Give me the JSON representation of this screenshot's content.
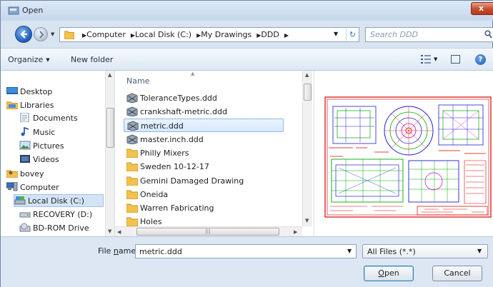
{
  "window": {
    "title": "Open",
    "close_glyph": "x"
  },
  "address": {
    "crumbs": [
      "Computer",
      "Local Disk (C:)",
      "My Drawings",
      "DDD"
    ],
    "search_placeholder": "Search DDD"
  },
  "toolbar": {
    "organize": "Organize",
    "new_folder": "New folder"
  },
  "nav": {
    "items": [
      {
        "label": "Desktop",
        "icon": "desktop-icon"
      },
      {
        "label": "Libraries",
        "icon": "libraries-icon"
      },
      {
        "label": "Documents",
        "icon": "documents-icon"
      },
      {
        "label": "Music",
        "icon": "music-icon"
      },
      {
        "label": "Pictures",
        "icon": "pictures-icon"
      },
      {
        "label": "Videos",
        "icon": "videos-icon"
      },
      {
        "label": "bovey",
        "icon": "user-folder-icon"
      },
      {
        "label": "Computer",
        "icon": "computer-icon"
      },
      {
        "label": "Local Disk (C:)",
        "icon": "local-disk-icon",
        "selected": true
      },
      {
        "label": "RECOVERY (D:)",
        "icon": "drive-icon"
      },
      {
        "label": "BD-ROM Drive",
        "icon": "bd-rom-icon"
      }
    ]
  },
  "files": {
    "column_header": "Name",
    "items": [
      {
        "label": "ToleranceTypes.ddd",
        "icon": "ddd-file-icon"
      },
      {
        "label": "crankshaft-metric.ddd",
        "icon": "ddd-file-icon"
      },
      {
        "label": "metric.ddd",
        "icon": "ddd-file-icon",
        "selected": true
      },
      {
        "label": "master.inch.ddd",
        "icon": "ddd-file-icon"
      },
      {
        "label": "Philly Mixers",
        "icon": "folder-icon"
      },
      {
        "label": "Sweden 10-12-17",
        "icon": "folder-icon"
      },
      {
        "label": "Gemini Damaged Drawing",
        "icon": "folder-icon"
      },
      {
        "label": "Oneida",
        "icon": "folder-icon"
      },
      {
        "label": "Warren Fabricating",
        "icon": "folder-icon"
      },
      {
        "label": "Holes",
        "icon": "folder-icon"
      }
    ]
  },
  "bottom": {
    "filename_label_pre": "File ",
    "filename_label_u": "n",
    "filename_label_post": "ame:",
    "filename_value": "metric.ddd",
    "filter_value": "All Files (*.*)",
    "open_label_u": "O",
    "open_label_rest": "pen",
    "cancel_label": "Cancel"
  },
  "colors": {
    "drawing_red": "#e00000",
    "drawing_blue": "#1d1dd6",
    "drawing_green": "#00a800",
    "drawing_magenta": "#d000d0",
    "folder_yellow": "#f3c24a"
  }
}
